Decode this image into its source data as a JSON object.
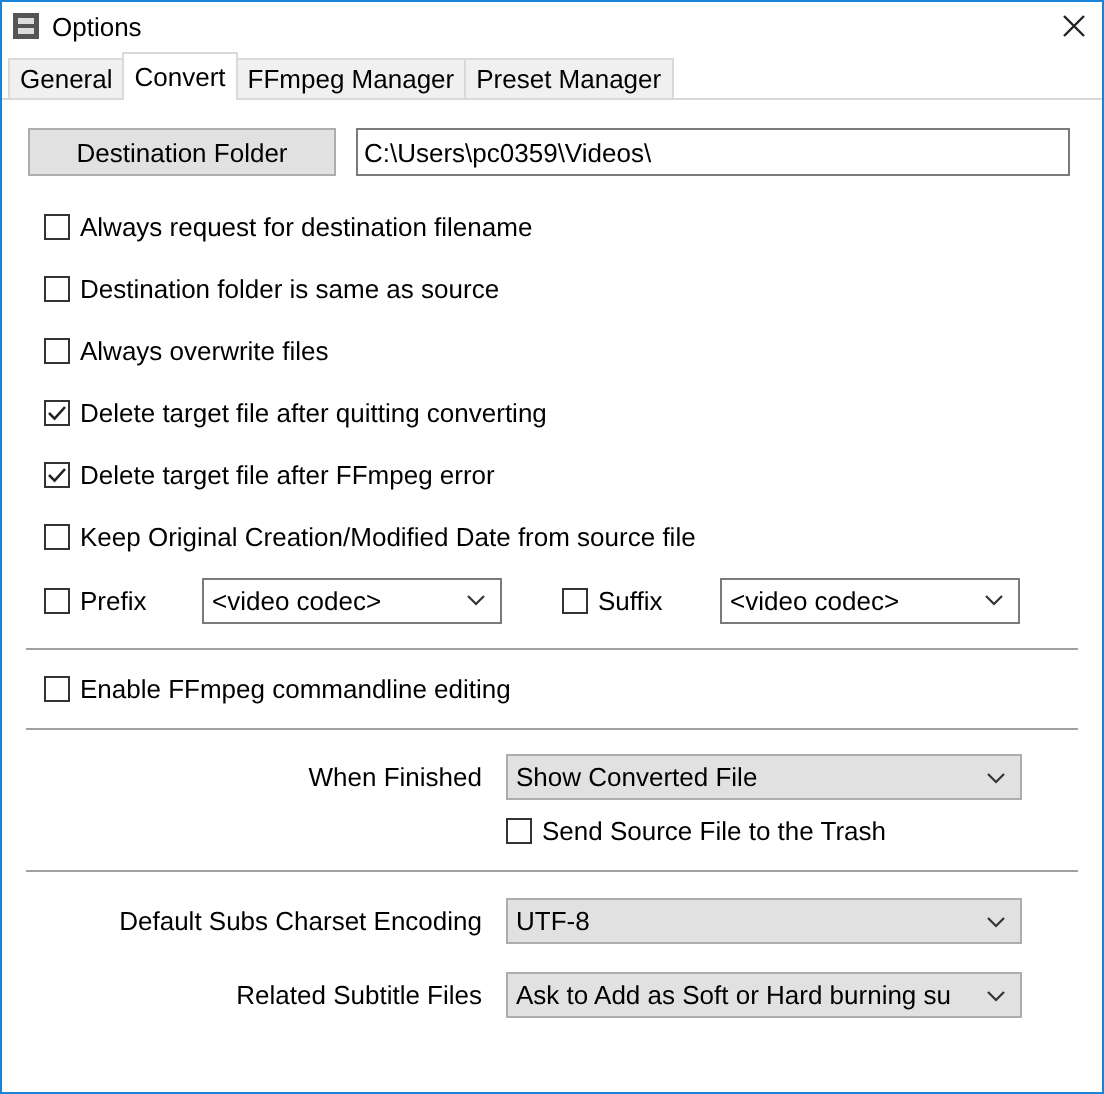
{
  "window": {
    "title": "Options"
  },
  "tabs": [
    {
      "label": "General",
      "selected": false
    },
    {
      "label": "Convert",
      "selected": true
    },
    {
      "label": "FFmpeg Manager",
      "selected": false
    },
    {
      "label": "Preset Manager",
      "selected": false
    }
  ],
  "destination": {
    "button": "Destination Folder",
    "path": "C:\\Users\\pc0359\\Videos\\"
  },
  "options": [
    {
      "label": "Always request for destination filename",
      "checked": false
    },
    {
      "label": "Destination folder is same as source",
      "checked": false
    },
    {
      "label": "Always overwrite files",
      "checked": false
    },
    {
      "label": "Delete target file after quitting converting",
      "checked": true
    },
    {
      "label": "Delete target file after FFmpeg error",
      "checked": true
    },
    {
      "label": "Keep Original Creation/Modified Date from source file",
      "checked": false
    }
  ],
  "naming": [
    {
      "label": "Prefix",
      "checked": false,
      "value": "<video codec>"
    },
    {
      "label": "Suffix",
      "checked": false,
      "value": "<video codec>"
    }
  ],
  "commandline": {
    "label": "Enable FFmpeg commandline editing",
    "checked": false
  },
  "when_finished": {
    "label": "When Finished",
    "value": "Show Converted File",
    "trash": {
      "label": "Send Source File to the Trash",
      "checked": false
    }
  },
  "subtitles": [
    {
      "label": "Default Subs Charset Encoding",
      "value": "UTF-8"
    },
    {
      "label": "Related Subtitle Files",
      "value": "Ask to Add as Soft or Hard burning su"
    }
  ]
}
